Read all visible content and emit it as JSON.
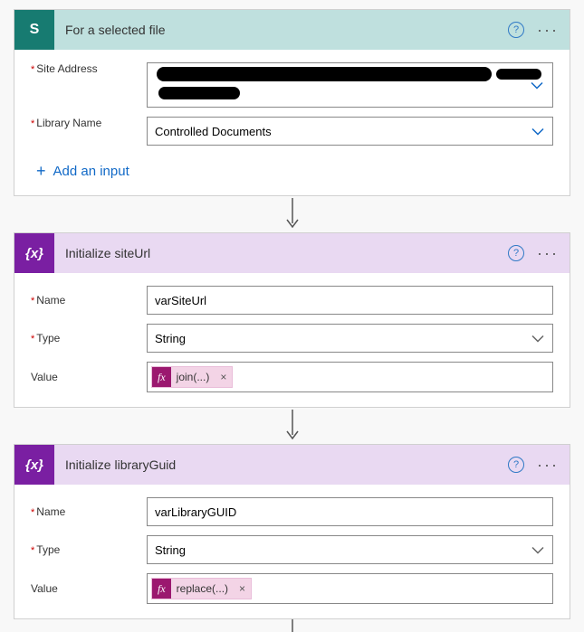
{
  "card1": {
    "icon_letter": "S",
    "title": "For a selected file",
    "fields": {
      "site_address_label": "Site Address",
      "library_name_label": "Library Name",
      "library_name_value": "Controlled Documents"
    },
    "add_input_label": "Add an input"
  },
  "card2": {
    "icon_glyph": "{x}",
    "title": "Initialize siteUrl",
    "fields": {
      "name_label": "Name",
      "name_value": "varSiteUrl",
      "type_label": "Type",
      "type_value": "String",
      "value_label": "Value",
      "value_expr": "join(...)"
    }
  },
  "card3": {
    "icon_glyph": "{x}",
    "title": "Initialize libraryGuid",
    "fields": {
      "name_label": "Name",
      "name_value": "varLibraryGUID",
      "type_label": "Type",
      "type_value": "String",
      "value_label": "Value",
      "value_expr": "replace(...)"
    }
  },
  "fx_badge": "fx",
  "help_glyph": "?"
}
